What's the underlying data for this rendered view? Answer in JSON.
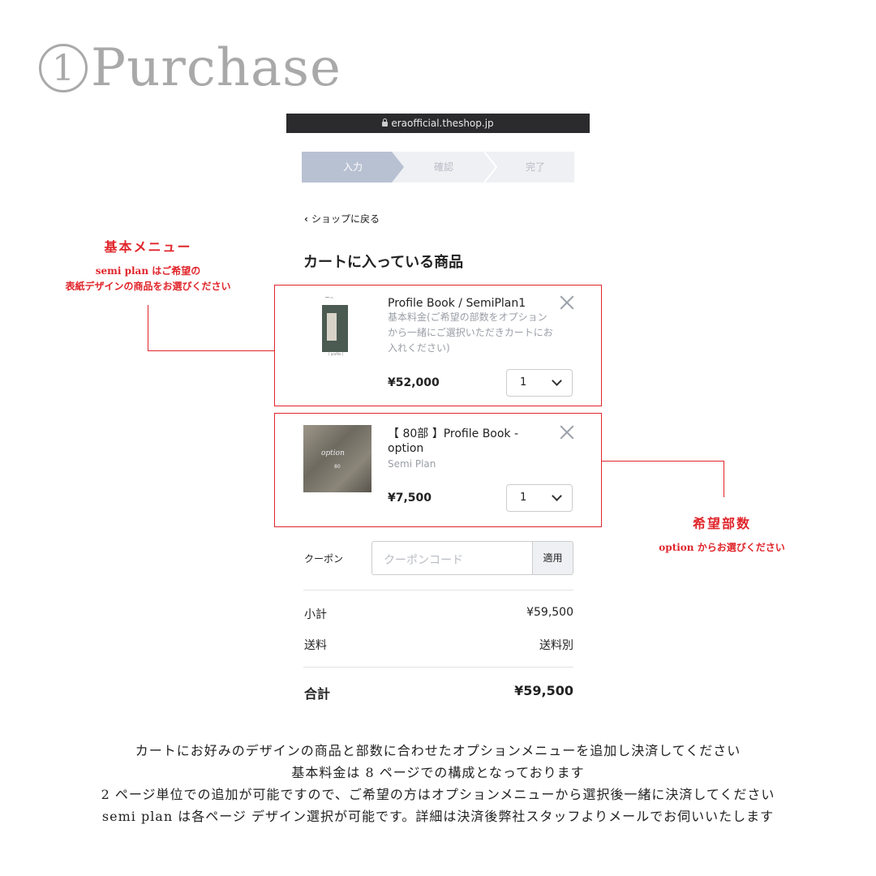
{
  "heading": {
    "number": "1",
    "word": "Purchase"
  },
  "browser": {
    "url": "eraofficial.theshop.jp"
  },
  "steps": [
    "入力",
    "確認",
    "完了"
  ],
  "back_link": "ショップに戻る",
  "cart_title": "カートに入っている商品",
  "items": [
    {
      "name": "Profile Book / SemiPlan1",
      "desc": "基本料金(ご希望の部数をオプションから一緒にご選択いただきカートにお入れください)",
      "price": "¥52,000",
      "qty": "1",
      "cover_label": "[ profile ]"
    },
    {
      "name": "【 80部 】Profile Book - option",
      "desc": "Semi Plan",
      "price": "¥7,500",
      "qty": "1",
      "cover_text": "option",
      "cover_num": "80"
    }
  ],
  "coupon": {
    "label": "クーポン",
    "placeholder": "クーポンコード",
    "button": "適用"
  },
  "summary": {
    "subtotal_label": "小計",
    "subtotal": "¥59,500",
    "shipping_label": "送料",
    "shipping": "送料別",
    "total_label": "合計",
    "total": "¥59,500"
  },
  "annotations": {
    "left_title": "基本メニュー",
    "left_sub1": "semi plan はご希望の",
    "left_sub2": "表紙デザインの商品をお選びください",
    "right_title": "希望部数",
    "right_sub": "option からお選びください"
  },
  "footer_lines": [
    "カートにお好みのデザインの商品と部数に合わせたオプションメニューを追加し決済してください",
    "基本料金は 8 ページでの構成となっております",
    "2 ページ単位での追加が可能ですので、ご希望の方はオプションメニューから選択後一緒に決済してください",
    "semi plan は各ページ デザイン選択が可能です。詳細は決済後弊社スタッフよりメールでお伺いいたします"
  ],
  "colors": {
    "accent": "#e0252b",
    "step_active": "#b8c1d2",
    "heading": "#a9a9a9"
  }
}
